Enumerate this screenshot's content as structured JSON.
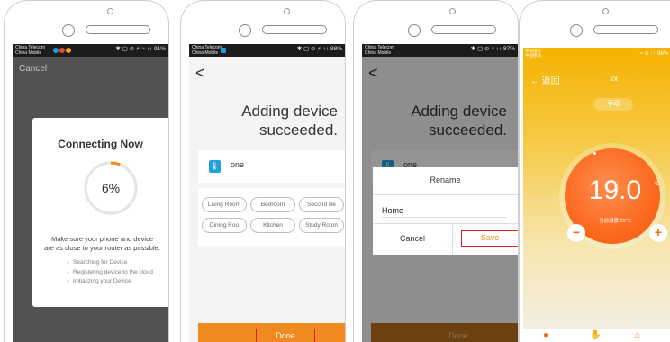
{
  "screen1": {
    "status_carrier": "China Telecom\nChina Mobile",
    "status_right": "✱ ▢ ⊙ ⚡ ≈ ↑↑ 91%",
    "cancel": "Cancel",
    "title": "Connecting Now",
    "percent": "6%",
    "progress_value": 0.06,
    "hint_line1": "Make sure your phone and device",
    "hint_line2": "are as close to your router as possible.",
    "steps": [
      "Searching for Device",
      "Registering device to the cloud",
      "Initializing your Device"
    ]
  },
  "screen2": {
    "status_carrier": "China Telecom\nChina Mobile",
    "status_right": "✱ ▢ ⊙ ⚡ ↑↑ 88%",
    "back": "<",
    "heading_line1": "Adding device",
    "heading_line2": "succeeded.",
    "device_name": "one",
    "rooms": [
      "Living Room",
      "Bedroom",
      "Second Be",
      "Dining Roo",
      "Kitchen",
      "Study Room"
    ],
    "done": "Done"
  },
  "screen3": {
    "status_carrier": "China Telecom\nChina Mobile",
    "status_right": "✱ ▢ ⊙ ≈ ↑↑ 87%",
    "back": "<",
    "heading_line1": "Adding device",
    "heading_line2": "succeeded.",
    "device_name": "one",
    "dialog_title": "Rename",
    "input_value": "Home",
    "cancel": "Cancel",
    "save": "Save",
    "done": "Done"
  },
  "screen4": {
    "status_carrier": "中国电信\n中国移动",
    "status_right": "≈ ⊙ ↑↑ 98%",
    "back": "← 返回",
    "title": "xx",
    "mode": "手动",
    "temperature": "19.0",
    "unit": "℃",
    "current_label": "当前温度 29℃",
    "minus": "−",
    "plus": "+"
  },
  "colors": {
    "accent_orange": "#f08a1e",
    "highlight_red": "#e01b1b",
    "dial_orange": "#fb6a1f",
    "device_icon_blue": "#1fa3dd"
  }
}
